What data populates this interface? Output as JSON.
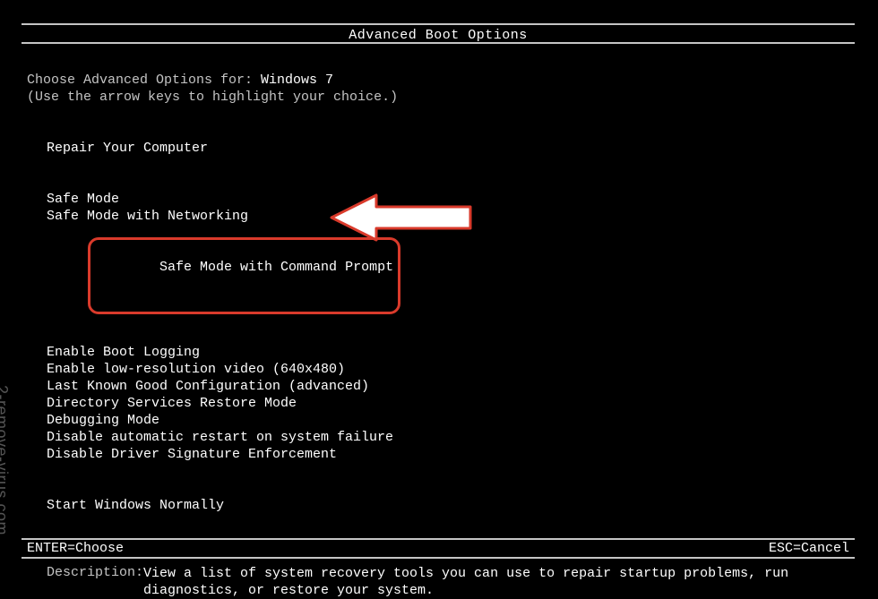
{
  "title": "Advanced Boot Options",
  "prompt": {
    "prefix": "Choose Advanced Options for: ",
    "os": "Windows 7",
    "hint": "(Use the arrow keys to highlight your choice.)"
  },
  "group_repair": {
    "item0": "Repair Your Computer"
  },
  "group_safe": {
    "item0": "Safe Mode",
    "item1": "Safe Mode with Networking",
    "item2": "Safe Mode with Command Prompt"
  },
  "group_advanced": {
    "item0": "Enable Boot Logging",
    "item1": "Enable low-resolution video (640x480)",
    "item2": "Last Known Good Configuration (advanced)",
    "item3": "Directory Services Restore Mode",
    "item4": "Debugging Mode",
    "item5": "Disable automatic restart on system failure",
    "item6": "Disable Driver Signature Enforcement"
  },
  "group_normal": {
    "item0": "Start Windows Normally"
  },
  "description": {
    "label": "Description:",
    "text": "View a list of system recovery tools you can use to repair startup problems, run diagnostics, or restore your system."
  },
  "footer": {
    "enter": "ENTER=Choose",
    "esc": "ESC=Cancel"
  },
  "watermark": "2-remove-virus.com",
  "annotation": {
    "highlight_color": "#d93a2b",
    "arrow_fill": "#ffffff"
  }
}
